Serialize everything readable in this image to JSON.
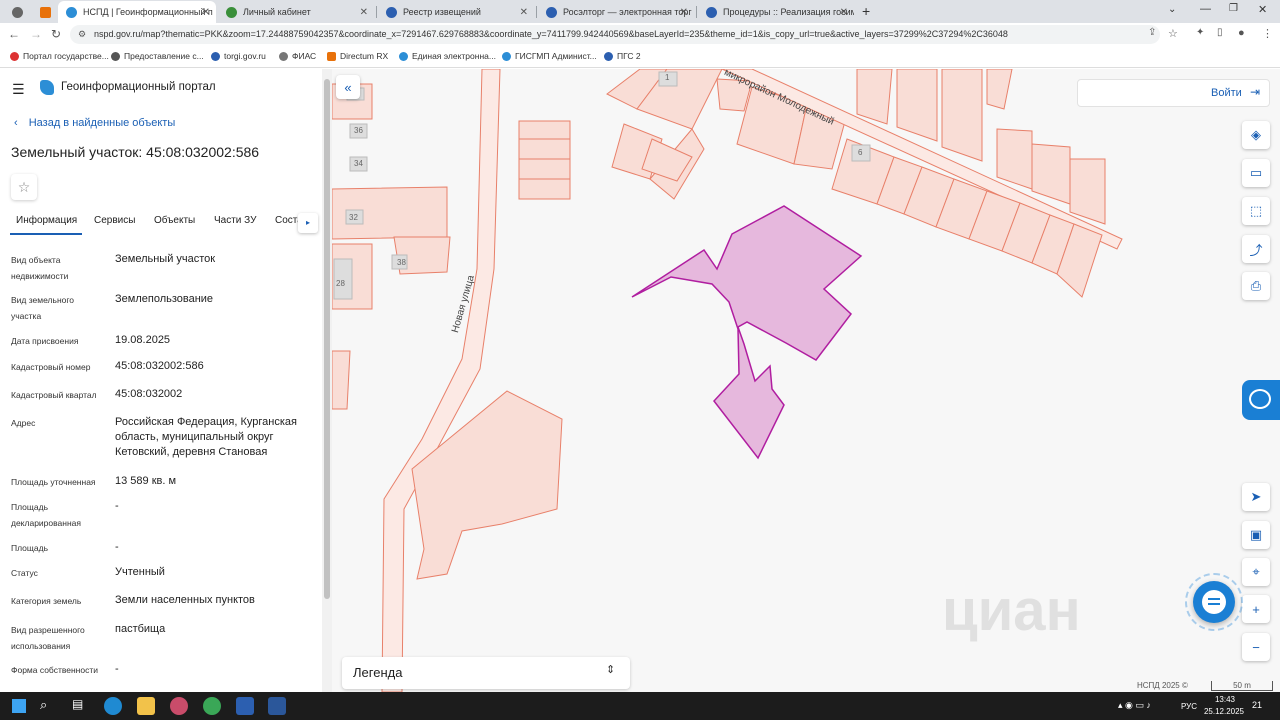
{
  "browser": {
    "tabs": [
      {
        "label": "",
        "color": "#e8710a"
      },
      {
        "label": "НСПД | Геоинформационный п",
        "color": "#2c8ed6"
      },
      {
        "label": "Личный кабинет",
        "color": "#3a8f3a"
      },
      {
        "label": "Реестр извещений",
        "color": "#2c5fb0"
      },
      {
        "label": "Росэлторг — электронная торг",
        "color": "#2c5fb0"
      },
      {
        "label": "Процедуры :: Реализация госим",
        "color": "#2c5fb0"
      }
    ],
    "new_tab": "+",
    "url": "nspd.gov.ru/map?thematic=PKK&zoom=17.24488759042357&coordinate_x=7291467.629768883&coordinate_y=7411799.942440569&baseLayerId=235&theme_id=1&is_copy_url=true&active_layers=37299%2C37294%2C36048",
    "bookmarks": [
      {
        "label": "Портал государстве...",
        "color": "#d33"
      },
      {
        "label": "Предоставление с...",
        "color": "#555"
      },
      {
        "label": "torgi.gov.ru",
        "color": "#2c5fb0"
      },
      {
        "label": "ФИАС",
        "color": "#777"
      },
      {
        "label": "Directum RX",
        "color": "#e8710a"
      },
      {
        "label": "Единая электронна...",
        "color": "#2c8ed6"
      },
      {
        "label": "ГИСГМП Админист...",
        "color": "#2c8ed6"
      },
      {
        "label": "ПГС 2",
        "color": "#2c5fb0"
      }
    ]
  },
  "portal": {
    "title": "Геоинформационный портал",
    "back_link": "Назад в найденные объекты",
    "object_title": "Земельный участок: 45:08:032002:586",
    "tabs": [
      "Информация",
      "Сервисы",
      "Объекты",
      "Части ЗУ",
      "Соста"
    ],
    "fields": [
      {
        "label": "Вид объекта недвижимости",
        "value": "Земельный участок"
      },
      {
        "label": "Вид земельного участка",
        "value": "Землепользование"
      },
      {
        "label": "Дата присвоения",
        "value": "19.08.2025"
      },
      {
        "label": "Кадастровый номер",
        "value": "45:08:032002:586"
      },
      {
        "label": "Кадастровый квартал",
        "value": "45:08:032002"
      },
      {
        "label": "Адрес",
        "value": "Российская Федерация, Курганская область, муниципальный округ Кетовский, деревня Становая"
      },
      {
        "label": "Площадь уточненная",
        "value": "13 589 кв. м"
      },
      {
        "label": "Площадь декларированная",
        "value": "-"
      },
      {
        "label": "Площадь",
        "value": "-"
      },
      {
        "label": "Статус",
        "value": "Учтенный"
      },
      {
        "label": "Категория земель",
        "value": "Земли населенных пунктов"
      },
      {
        "label": "Вид разрешенного использования",
        "value": "пастбища"
      },
      {
        "label": "Форма собственности",
        "value": "-"
      }
    ]
  },
  "map": {
    "login": "Войти",
    "legend": "Легенда",
    "street_1": "Новая улица",
    "street_2": "микрорайон Молодежный",
    "house_numbers": [
      "1",
      "6",
      "36",
      "34",
      "32",
      "38",
      "28",
      "38"
    ],
    "copyright": "НСПД 2025 ©",
    "scale": "50 m",
    "watermark": "циан",
    "colors": {
      "parcel_fill": "#f9ddd6",
      "parcel_stroke": "#e8806a",
      "selected_fill": "#e6b8dd",
      "selected_stroke": "#b01ea0",
      "accent": "#1a5fb4"
    }
  },
  "taskbar": {
    "lang": "РУС",
    "time": "13:43",
    "date": "25.12.2025",
    "notifications": "21"
  }
}
